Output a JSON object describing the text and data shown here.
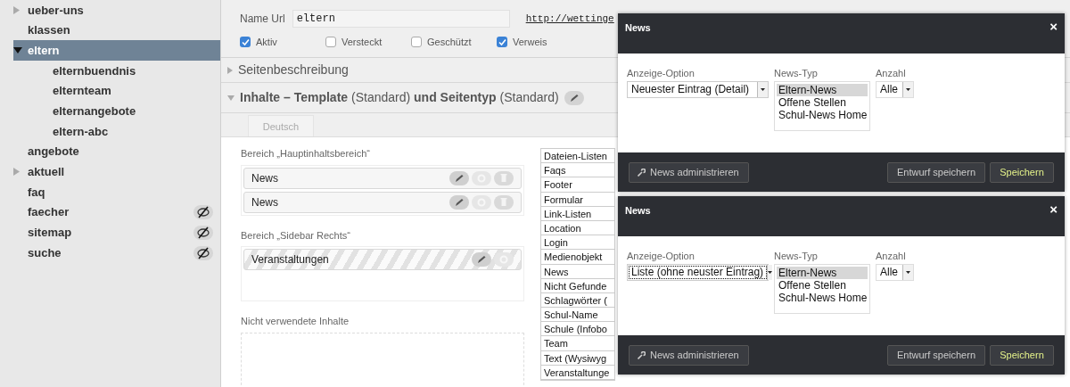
{
  "sidebar": {
    "items": [
      {
        "label": "ueber-uns",
        "expanded": false,
        "selected": false,
        "hidden": false
      },
      {
        "label": "klassen",
        "selected": false,
        "hidden": false
      },
      {
        "label": "eltern",
        "expanded": true,
        "selected": true,
        "hidden": false,
        "children": [
          {
            "label": "elternbuendnis",
            "selected": false,
            "hidden": false
          },
          {
            "label": "elternteam",
            "selected": false,
            "hidden": false
          },
          {
            "label": "elternangebote",
            "selected": false,
            "hidden": false
          },
          {
            "label": "eltern-abc",
            "selected": false,
            "hidden": false
          }
        ]
      },
      {
        "label": "angebote",
        "selected": false,
        "hidden": false
      },
      {
        "label": "aktuell",
        "expanded": false,
        "selected": false,
        "hidden": false
      },
      {
        "label": "faq",
        "selected": false,
        "hidden": false
      },
      {
        "label": "faecher",
        "selected": false,
        "hidden": true
      },
      {
        "label": "sitemap",
        "selected": false,
        "hidden": true
      },
      {
        "label": "suche",
        "selected": false,
        "hidden": true
      }
    ]
  },
  "page": {
    "name_url_label": "Name Url",
    "name_url_value": "eltern",
    "url": "http://wettinge",
    "checkboxes": [
      {
        "label": "Aktiv",
        "checked": true
      },
      {
        "label": "Versteckt",
        "checked": false
      },
      {
        "label": "Geschützt",
        "checked": false
      },
      {
        "label": "Verweis",
        "checked": true
      }
    ],
    "sections": [
      {
        "title": "Seitenbeschreibung",
        "expanded": false
      },
      {
        "title": "**Inhalte – Template** (Standard) **und Seitentyp** (Standard)",
        "expanded": true
      }
    ],
    "language_tab": "Deutsch",
    "areas": [
      {
        "title": "Bereich „Hauptinhaltsbereich“",
        "blocks": [
          {
            "label": "News",
            "striped": false,
            "deletable": true
          },
          {
            "label": "News",
            "striped": false,
            "deletable": true
          }
        ]
      },
      {
        "title": "Bereich „Sidebar Rechts“",
        "blocks": [
          {
            "label": "Veranstaltungen",
            "striped": true,
            "deletable": false
          }
        ]
      }
    ],
    "unused_title": "Nicht verwendete Inhalte",
    "content_types": [
      "Dateien-Listen",
      "Faqs",
      "Footer",
      "Formular",
      "Link-Listen",
      "Location",
      "Login",
      "Medienobjekt",
      "News",
      "Nicht Gefunde",
      "Schlagwörter (",
      "Schul-Name",
      "Schule (Infobo",
      "Team",
      "Text (Wysiwyg",
      "Veranstaltunge"
    ]
  },
  "dialogs": [
    {
      "title": "News",
      "close": "×",
      "display_label": "Anzeige-Option",
      "display_value": "Neuester Eintrag (Detail)",
      "display_focused": false,
      "type_label": "News-Typ",
      "types": [
        {
          "label": "Eltern-News",
          "selected": true
        },
        {
          "label": "Offene Stellen",
          "selected": false
        },
        {
          "label": "Schul-News Home",
          "selected": false
        }
      ],
      "count_label": "Anzahl",
      "count_value": "Alle",
      "admin_button": "News administrieren",
      "draft_button": "Entwurf speichern",
      "save_button": "Speichern"
    },
    {
      "title": "News",
      "close": "×",
      "display_label": "Anzeige-Option",
      "display_value": "Liste (ohne neuster Eintrag)",
      "display_focused": true,
      "type_label": "News-Typ",
      "types": [
        {
          "label": "Eltern-News",
          "selected": true
        },
        {
          "label": "Offene Stellen",
          "selected": false
        },
        {
          "label": "Schul-News Home",
          "selected": false
        }
      ],
      "count_label": "Anzahl",
      "count_value": "Alle",
      "admin_button": "News administrieren",
      "draft_button": "Entwurf speichern",
      "save_button": "Speichern"
    }
  ]
}
